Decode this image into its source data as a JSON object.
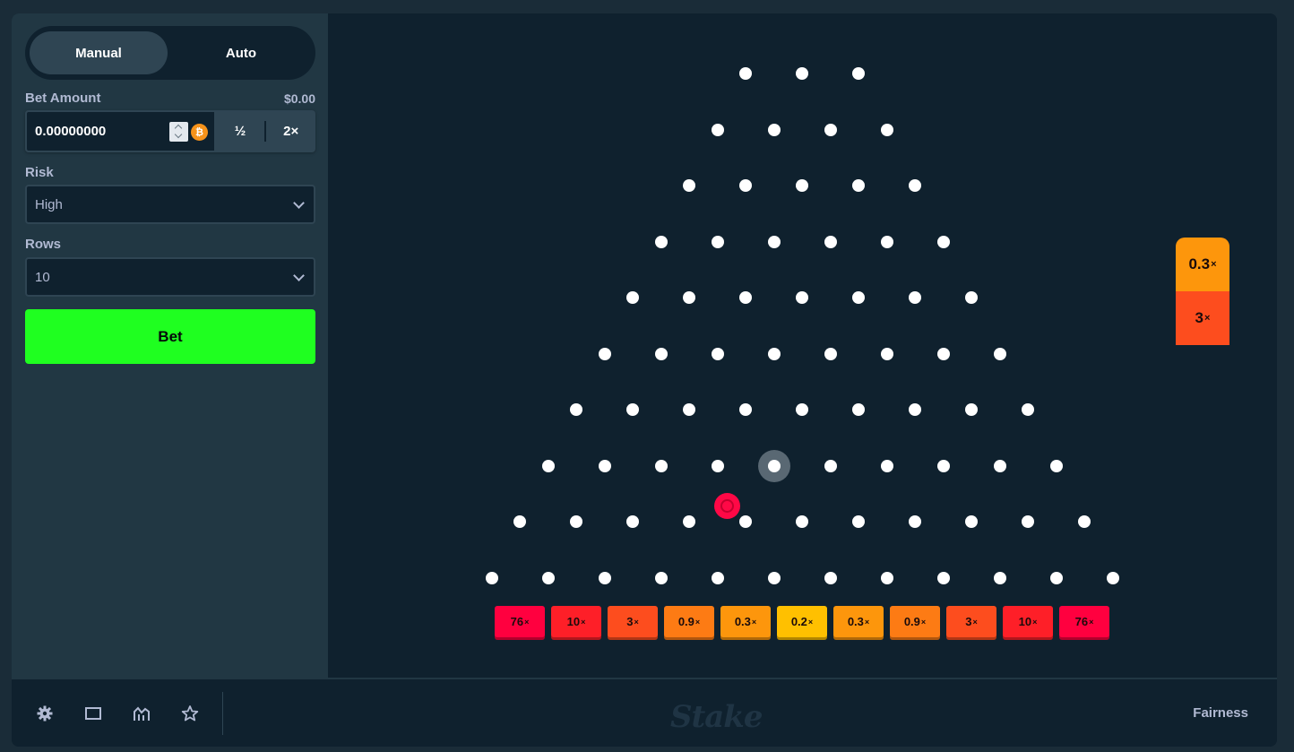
{
  "controls": {
    "mode_tabs": [
      {
        "label": "Manual",
        "active": true
      },
      {
        "label": "Auto",
        "active": false
      }
    ],
    "bet_amount_label": "Bet Amount",
    "bet_amount_usd": "$0.00",
    "bet_amount_value": "0.00000000",
    "currency_icon": "bitcoin-icon",
    "half_label": "½",
    "double_label": "2×",
    "risk_label": "Risk",
    "risk_value": "High",
    "rows_label": "Rows",
    "rows_value": "10",
    "bet_button_label": "Bet",
    "bet_button_color": "#1fff20"
  },
  "board": {
    "rows": 10,
    "buckets": [
      {
        "mult": "76",
        "color": "#ff003f"
      },
      {
        "mult": "10",
        "color": "#fe1f28"
      },
      {
        "mult": "3",
        "color": "#fd4d1e"
      },
      {
        "mult": "0.9",
        "color": "#fd7b14"
      },
      {
        "mult": "0.3",
        "color": "#fd960c"
      },
      {
        "mult": "0.2",
        "color": "#ffc000"
      },
      {
        "mult": "0.3",
        "color": "#fd960c"
      },
      {
        "mult": "0.9",
        "color": "#fd7b14"
      },
      {
        "mult": "3",
        "color": "#fd4d1e"
      },
      {
        "mult": "10",
        "color": "#fe1f28"
      },
      {
        "mult": "76",
        "color": "#ff003f"
      }
    ],
    "history": [
      {
        "mult": "0.3",
        "color": "#fd960c"
      },
      {
        "mult": "3",
        "color": "#fd4d1e"
      }
    ],
    "multiplier_suffix": "×"
  },
  "footer": {
    "icons": [
      "gear-icon",
      "square-icon",
      "chart-icon",
      "star-icon"
    ],
    "logo": "Stake",
    "fairness_label": "Fairness"
  }
}
